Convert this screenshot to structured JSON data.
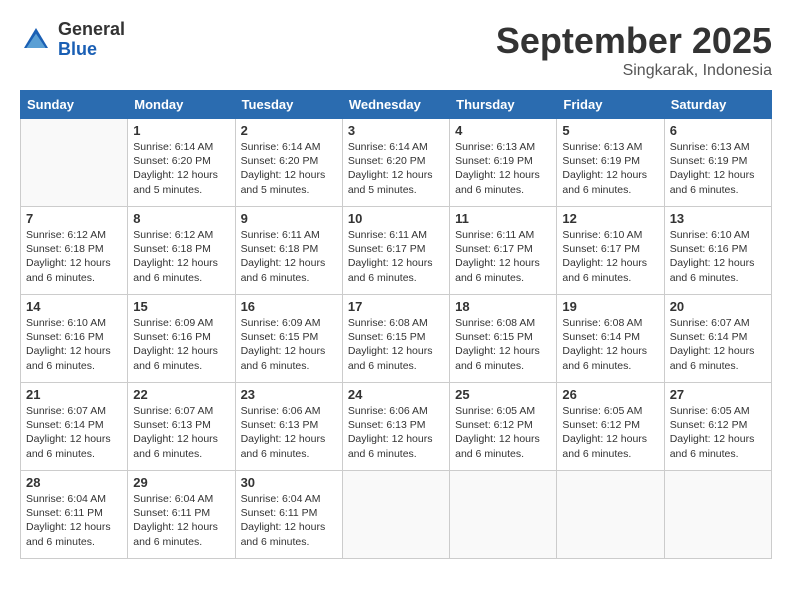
{
  "header": {
    "logo_general": "General",
    "logo_blue": "Blue",
    "month": "September 2025",
    "location": "Singkarak, Indonesia"
  },
  "weekdays": [
    "Sunday",
    "Monday",
    "Tuesday",
    "Wednesday",
    "Thursday",
    "Friday",
    "Saturday"
  ],
  "weeks": [
    [
      {
        "day": "",
        "sunrise": "",
        "sunset": "",
        "daylight": ""
      },
      {
        "day": "1",
        "sunrise": "Sunrise: 6:14 AM",
        "sunset": "Sunset: 6:20 PM",
        "daylight": "Daylight: 12 hours and 5 minutes."
      },
      {
        "day": "2",
        "sunrise": "Sunrise: 6:14 AM",
        "sunset": "Sunset: 6:20 PM",
        "daylight": "Daylight: 12 hours and 5 minutes."
      },
      {
        "day": "3",
        "sunrise": "Sunrise: 6:14 AM",
        "sunset": "Sunset: 6:20 PM",
        "daylight": "Daylight: 12 hours and 5 minutes."
      },
      {
        "day": "4",
        "sunrise": "Sunrise: 6:13 AM",
        "sunset": "Sunset: 6:19 PM",
        "daylight": "Daylight: 12 hours and 6 minutes."
      },
      {
        "day": "5",
        "sunrise": "Sunrise: 6:13 AM",
        "sunset": "Sunset: 6:19 PM",
        "daylight": "Daylight: 12 hours and 6 minutes."
      },
      {
        "day": "6",
        "sunrise": "Sunrise: 6:13 AM",
        "sunset": "Sunset: 6:19 PM",
        "daylight": "Daylight: 12 hours and 6 minutes."
      }
    ],
    [
      {
        "day": "7",
        "sunrise": "Sunrise: 6:12 AM",
        "sunset": "Sunset: 6:18 PM",
        "daylight": "Daylight: 12 hours and 6 minutes."
      },
      {
        "day": "8",
        "sunrise": "Sunrise: 6:12 AM",
        "sunset": "Sunset: 6:18 PM",
        "daylight": "Daylight: 12 hours and 6 minutes."
      },
      {
        "day": "9",
        "sunrise": "Sunrise: 6:11 AM",
        "sunset": "Sunset: 6:18 PM",
        "daylight": "Daylight: 12 hours and 6 minutes."
      },
      {
        "day": "10",
        "sunrise": "Sunrise: 6:11 AM",
        "sunset": "Sunset: 6:17 PM",
        "daylight": "Daylight: 12 hours and 6 minutes."
      },
      {
        "day": "11",
        "sunrise": "Sunrise: 6:11 AM",
        "sunset": "Sunset: 6:17 PM",
        "daylight": "Daylight: 12 hours and 6 minutes."
      },
      {
        "day": "12",
        "sunrise": "Sunrise: 6:10 AM",
        "sunset": "Sunset: 6:17 PM",
        "daylight": "Daylight: 12 hours and 6 minutes."
      },
      {
        "day": "13",
        "sunrise": "Sunrise: 6:10 AM",
        "sunset": "Sunset: 6:16 PM",
        "daylight": "Daylight: 12 hours and 6 minutes."
      }
    ],
    [
      {
        "day": "14",
        "sunrise": "Sunrise: 6:10 AM",
        "sunset": "Sunset: 6:16 PM",
        "daylight": "Daylight: 12 hours and 6 minutes."
      },
      {
        "day": "15",
        "sunrise": "Sunrise: 6:09 AM",
        "sunset": "Sunset: 6:16 PM",
        "daylight": "Daylight: 12 hours and 6 minutes."
      },
      {
        "day": "16",
        "sunrise": "Sunrise: 6:09 AM",
        "sunset": "Sunset: 6:15 PM",
        "daylight": "Daylight: 12 hours and 6 minutes."
      },
      {
        "day": "17",
        "sunrise": "Sunrise: 6:08 AM",
        "sunset": "Sunset: 6:15 PM",
        "daylight": "Daylight: 12 hours and 6 minutes."
      },
      {
        "day": "18",
        "sunrise": "Sunrise: 6:08 AM",
        "sunset": "Sunset: 6:15 PM",
        "daylight": "Daylight: 12 hours and 6 minutes."
      },
      {
        "day": "19",
        "sunrise": "Sunrise: 6:08 AM",
        "sunset": "Sunset: 6:14 PM",
        "daylight": "Daylight: 12 hours and 6 minutes."
      },
      {
        "day": "20",
        "sunrise": "Sunrise: 6:07 AM",
        "sunset": "Sunset: 6:14 PM",
        "daylight": "Daylight: 12 hours and 6 minutes."
      }
    ],
    [
      {
        "day": "21",
        "sunrise": "Sunrise: 6:07 AM",
        "sunset": "Sunset: 6:14 PM",
        "daylight": "Daylight: 12 hours and 6 minutes."
      },
      {
        "day": "22",
        "sunrise": "Sunrise: 6:07 AM",
        "sunset": "Sunset: 6:13 PM",
        "daylight": "Daylight: 12 hours and 6 minutes."
      },
      {
        "day": "23",
        "sunrise": "Sunrise: 6:06 AM",
        "sunset": "Sunset: 6:13 PM",
        "daylight": "Daylight: 12 hours and 6 minutes."
      },
      {
        "day": "24",
        "sunrise": "Sunrise: 6:06 AM",
        "sunset": "Sunset: 6:13 PM",
        "daylight": "Daylight: 12 hours and 6 minutes."
      },
      {
        "day": "25",
        "sunrise": "Sunrise: 6:05 AM",
        "sunset": "Sunset: 6:12 PM",
        "daylight": "Daylight: 12 hours and 6 minutes."
      },
      {
        "day": "26",
        "sunrise": "Sunrise: 6:05 AM",
        "sunset": "Sunset: 6:12 PM",
        "daylight": "Daylight: 12 hours and 6 minutes."
      },
      {
        "day": "27",
        "sunrise": "Sunrise: 6:05 AM",
        "sunset": "Sunset: 6:12 PM",
        "daylight": "Daylight: 12 hours and 6 minutes."
      }
    ],
    [
      {
        "day": "28",
        "sunrise": "Sunrise: 6:04 AM",
        "sunset": "Sunset: 6:11 PM",
        "daylight": "Daylight: 12 hours and 6 minutes."
      },
      {
        "day": "29",
        "sunrise": "Sunrise: 6:04 AM",
        "sunset": "Sunset: 6:11 PM",
        "daylight": "Daylight: 12 hours and 6 minutes."
      },
      {
        "day": "30",
        "sunrise": "Sunrise: 6:04 AM",
        "sunset": "Sunset: 6:11 PM",
        "daylight": "Daylight: 12 hours and 6 minutes."
      },
      {
        "day": "",
        "sunrise": "",
        "sunset": "",
        "daylight": ""
      },
      {
        "day": "",
        "sunrise": "",
        "sunset": "",
        "daylight": ""
      },
      {
        "day": "",
        "sunrise": "",
        "sunset": "",
        "daylight": ""
      },
      {
        "day": "",
        "sunrise": "",
        "sunset": "",
        "daylight": ""
      }
    ]
  ]
}
